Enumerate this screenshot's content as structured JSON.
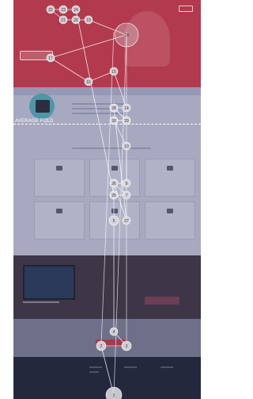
{
  "fold_label": "AVERAGE FOLD",
  "colors": {
    "hero": "#b23a4e",
    "section_light": "#a7a9c0",
    "section_dark": "#3e3646",
    "footer": "#24283d",
    "fixation": "#d8d8dc",
    "path": "#ffffff"
  },
  "fixations": [
    {
      "label": "1"
    },
    {
      "label": "2"
    },
    {
      "label": "3"
    },
    {
      "label": "4"
    },
    {
      "label": "5"
    },
    {
      "label": "6"
    },
    {
      "label": "7"
    },
    {
      "label": "8"
    },
    {
      "label": "9"
    },
    {
      "label": "10"
    },
    {
      "label": "11"
    },
    {
      "label": "12"
    },
    {
      "label": "13"
    },
    {
      "label": "14"
    },
    {
      "label": "15"
    },
    {
      "label": "16"
    },
    {
      "label": "17"
    },
    {
      "label": "18"
    },
    {
      "label": "19"
    },
    {
      "label": "20"
    },
    {
      "label": "21"
    },
    {
      "label": "22"
    },
    {
      "label": "23"
    },
    {
      "label": "24"
    },
    {
      "label": "25"
    },
    {
      "label": "26"
    },
    {
      "label": "27"
    },
    {
      "label": "28"
    },
    {
      "label": "29"
    },
    {
      "label": "30"
    }
  ]
}
